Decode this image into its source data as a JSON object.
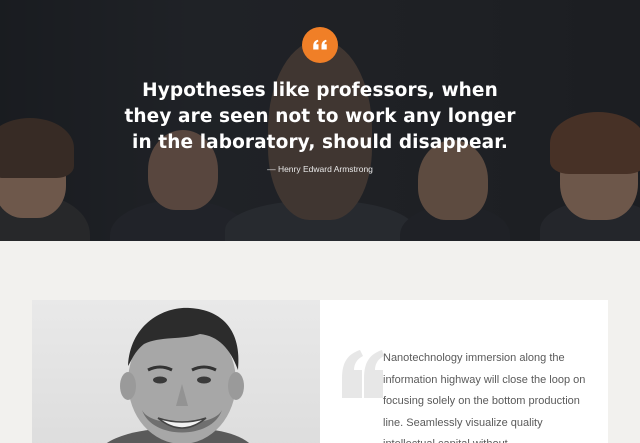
{
  "hero": {
    "quote_icon": "quote-left-icon",
    "quote_lines": [
      "Hypotheses like professors, when",
      "they are seen not to work any longer",
      "in the laboratory, should disappear."
    ],
    "author": "— Henry Edward Armstrong",
    "accent_color": "#f07f27"
  },
  "testimonial": {
    "quote_icon": "big-quote-icon",
    "text": "Nanotechnology immersion along the information highway will close the loop on focusing solely on the bottom production line.  Seamlessly visualize quality intellectual capital without"
  }
}
